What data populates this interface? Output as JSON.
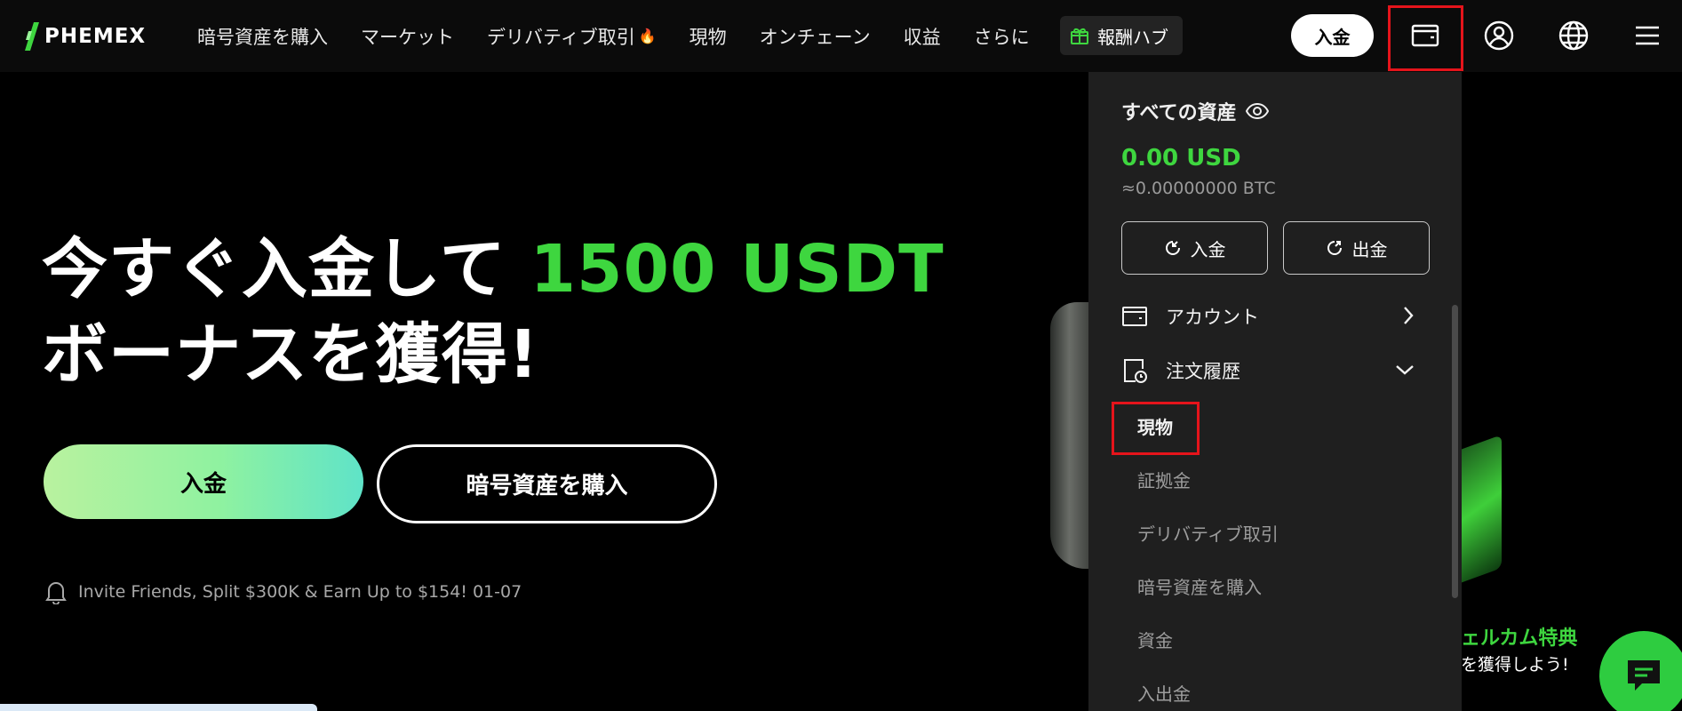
{
  "brand": {
    "logo_text": "PHEMEX"
  },
  "nav": {
    "items": [
      {
        "label": "暗号資産を購入"
      },
      {
        "label": "マーケット"
      },
      {
        "label": "デリバティブ取引"
      },
      {
        "label": "現物"
      },
      {
        "label": "オンチェーン"
      },
      {
        "label": "収益"
      },
      {
        "label": "さらに"
      }
    ],
    "reward_hub": "報酬ハブ",
    "deposit": "入金"
  },
  "hero": {
    "line1_prefix": "今すぐ入金して ",
    "line1_highlight": "1500 USDT",
    "line2": "ボーナスを獲得!",
    "deposit_button": "入金",
    "buy_button": "暗号資産を購入",
    "notice": "Invite Friends, Split $300K & Earn Up to $154!  01-07"
  },
  "welcome": {
    "title": "ェルカム特典",
    "subtitle": "を獲得しよう!"
  },
  "assets_panel": {
    "header": "すべての資産",
    "balance_usd": "0.00 USD",
    "balance_btc": "≈0.00000000 BTC",
    "deposit_btn": "入金",
    "withdraw_btn": "出金",
    "account": "アカウント",
    "order_history": "注文履歴",
    "sub_items": [
      {
        "label": "現物"
      },
      {
        "label": "証拠金"
      },
      {
        "label": "デリバティブ取引"
      },
      {
        "label": "暗号資産を購入"
      },
      {
        "label": "資金"
      },
      {
        "label": "入出金"
      }
    ]
  },
  "colors": {
    "accent_green": "#3ed63f",
    "highlight_red": "#e5141b",
    "panel_bg": "#1f1f1f"
  }
}
